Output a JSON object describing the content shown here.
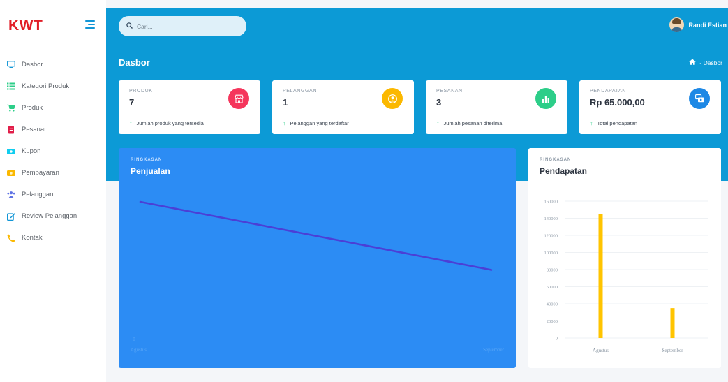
{
  "sidebar": {
    "brand": "KWT",
    "items": [
      {
        "label": "Dasbor",
        "icon": "monitor-icon",
        "color": "#1296d6"
      },
      {
        "label": "Kategori Produk",
        "icon": "list-icon",
        "color": "#2dce89"
      },
      {
        "label": "Produk",
        "icon": "cart-icon",
        "color": "#2dce89"
      },
      {
        "label": "Pesanan",
        "icon": "receipt-icon",
        "color": "#e11d48"
      },
      {
        "label": "Kupon",
        "icon": "ticket-icon",
        "color": "#11cdef"
      },
      {
        "label": "Pembayaran",
        "icon": "money-icon",
        "color": "#fbb800"
      },
      {
        "label": "Pelanggan",
        "icon": "users-icon",
        "color": "#5e72e4"
      },
      {
        "label": "Review Pelanggan",
        "icon": "edit-icon",
        "color": "#1296d6"
      },
      {
        "label": "Kontak",
        "icon": "phone-icon",
        "color": "#fbb800"
      }
    ]
  },
  "header": {
    "search_placeholder": "Cari...",
    "user_name": "Randi Estian"
  },
  "page": {
    "title": "Dasbor",
    "breadcrumb": "- Dasbor"
  },
  "cards": [
    {
      "label": "PRODUK",
      "value": "7",
      "desc": "Jumlah produk yang tersedia",
      "icon": "store-icon",
      "color": "#f5365c"
    },
    {
      "label": "PELANGGAN",
      "value": "1",
      "desc": "Pelanggan yang terdaftar",
      "icon": "user-circle-icon",
      "color": "#fbb800"
    },
    {
      "label": "PESANAN",
      "value": "3",
      "desc": "Jumlah pesanan diterima",
      "icon": "bar-chart-icon",
      "color": "#2dce89"
    },
    {
      "label": "PENDAPATAN",
      "value": "Rp 65.000,00",
      "desc": "Total pendapatan",
      "icon": "wallet-icon",
      "color": "#1e88e5"
    }
  ],
  "panels": {
    "sales": {
      "section": "RINGKASAN",
      "title": "Penjualan"
    },
    "revenue": {
      "section": "RINGKASAN",
      "title": "Pendapatan"
    }
  },
  "chart_data": [
    {
      "type": "line",
      "categories": [
        "Agustus",
        "September"
      ],
      "y_tick_visible": "0",
      "series": [
        {
          "values": [
            2,
            1
          ]
        }
      ],
      "color": "#4b3fd6",
      "grid": false
    },
    {
      "type": "bar",
      "categories": [
        "Agustus",
        "September"
      ],
      "series": [
        {
          "values": [
            145000,
            35000
          ]
        }
      ],
      "yticks": [
        0,
        20000,
        40000,
        60000,
        80000,
        100000,
        120000,
        140000,
        160000
      ],
      "ylim": [
        0,
        160000
      ],
      "color": "#ffc400",
      "grid": true
    }
  ]
}
